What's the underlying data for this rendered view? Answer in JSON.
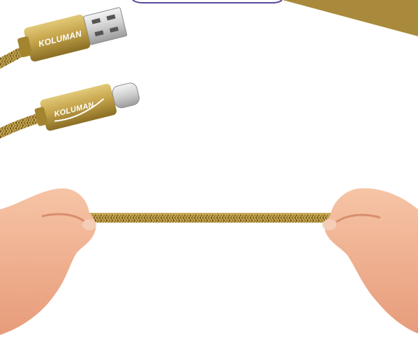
{
  "product": {
    "usb_a_connector": {
      "brand": "KOLUMAN"
    },
    "usb_c_connector": {
      "brand": "KOLUMAN"
    }
  },
  "colors": {
    "background": "#ffffff",
    "gold": "#b8973e",
    "gold_dark": "#8a6e24",
    "gold_light": "#e2c978",
    "corner_banner": "#a98a3c",
    "corner_frame": "#5a4a9c",
    "skin": "#f1b596",
    "skin_shadow": "#d88e6c"
  }
}
